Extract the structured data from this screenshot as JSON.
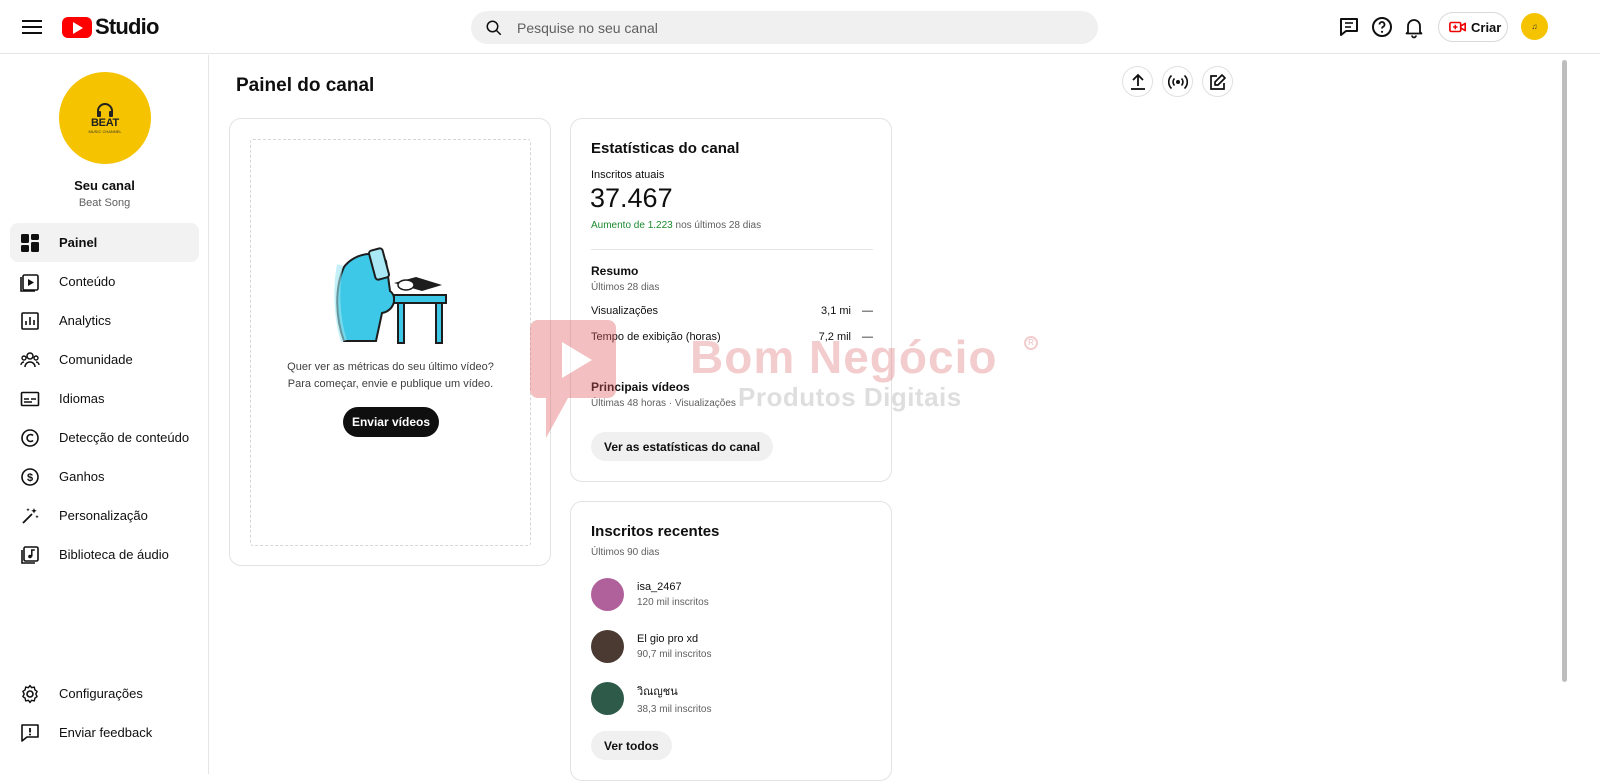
{
  "header": {
    "logo_text": "Studio",
    "search_placeholder": "Pesquise no seu canal",
    "create_label": "Criar"
  },
  "sidebar": {
    "channel_avatar_text": "BEAT",
    "channel_avatar_sub": "MUSIC CHANNEL",
    "channel_title": "Seu canal",
    "channel_name": "Beat Song",
    "items": [
      {
        "label": "Painel",
        "icon": "dashboard-icon"
      },
      {
        "label": "Conteúdo",
        "icon": "content-icon"
      },
      {
        "label": "Analytics",
        "icon": "analytics-icon"
      },
      {
        "label": "Comunidade",
        "icon": "community-icon"
      },
      {
        "label": "Idiomas",
        "icon": "subtitles-icon"
      },
      {
        "label": "Detecção de conteúdo",
        "icon": "copyright-icon"
      },
      {
        "label": "Ganhos",
        "icon": "dollar-icon"
      },
      {
        "label": "Personalização",
        "icon": "magic-wand-icon"
      },
      {
        "label": "Biblioteca de áudio",
        "icon": "audio-library-icon"
      }
    ],
    "bottom_items": [
      {
        "label": "Configurações",
        "icon": "gear-icon"
      },
      {
        "label": "Enviar feedback",
        "icon": "feedback-icon"
      }
    ]
  },
  "main": {
    "page_title": "Painel do canal",
    "latest_video": {
      "text_line1": "Quer ver as métricas do seu último vídeo?",
      "text_line2": "Para começar, envie e publique um vídeo.",
      "button": "Enviar vídeos"
    },
    "channel_stats": {
      "title": "Estatísticas do canal",
      "subs_label": "Inscritos atuais",
      "subs_count": "37.467",
      "growth_highlight": "Aumento de 1.223",
      "growth_rest": " nos últimos 28 dias",
      "summary_title": "Resumo",
      "summary_period": "Últimos 28 dias",
      "rows": [
        {
          "label": "Visualizações",
          "value": "3,1 mi",
          "change": "—"
        },
        {
          "label": "Tempo de exibição (horas)",
          "value": "7,2 mil",
          "change": "—"
        }
      ],
      "top_videos_title": "Principais vídeos",
      "top_videos_period": "Últimas 48 horas · Visualizações",
      "button": "Ver as estatísticas do canal"
    },
    "recent_subs": {
      "title": "Inscritos recentes",
      "period": "Últimos 90 dias",
      "items": [
        {
          "name": "isa_2467",
          "subs": "120 mil inscritos",
          "color": "#b0609a"
        },
        {
          "name": "El gio pro xd",
          "subs": "90,7 mil inscritos",
          "color": "#4a3a32"
        },
        {
          "name": "วิณญชน",
          "subs": "38,3 mil inscritos",
          "color": "#2e5a4a"
        }
      ],
      "button": "Ver todos"
    }
  },
  "watermark": {
    "line1": "Bom Negócio",
    "line2": "Produtos Digitais",
    "mark": "R"
  }
}
